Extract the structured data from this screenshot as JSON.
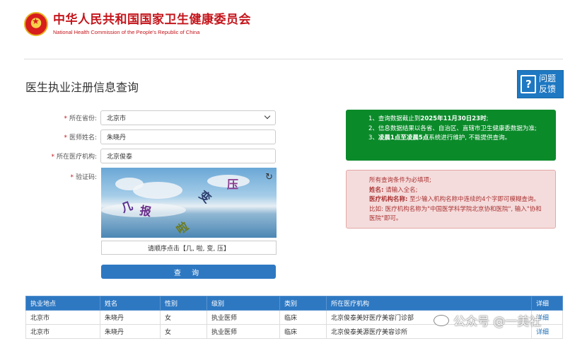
{
  "header": {
    "org_cn": "中华人民共和国国家卫生健康委员会",
    "org_en": "National Health Commission of the People's Republic of China"
  },
  "page_title": "医生执业注册信息查询",
  "feedback": {
    "line1": "问题",
    "line2": "反馈"
  },
  "form": {
    "province": {
      "label": "所在省份:",
      "value": "北京市"
    },
    "doctor_name": {
      "label": "医师姓名:",
      "value": "朱晓丹"
    },
    "institution": {
      "label": "所在医疗机构:",
      "value": "北京俊泰"
    },
    "captcha": {
      "label": "验证码:",
      "chars": [
        "几",
        "报",
        "啦",
        "变",
        "压"
      ],
      "hint": "请顺序点击【几, 啦, 变, 压】"
    },
    "query_button": "查 询"
  },
  "notice_green": {
    "line1_prefix": "1、查询数据截止到",
    "line1_bold": "2025年11月30日23时",
    "line1_suffix": ";",
    "line2": "2、信息数据结果以各省、自治区、直辖市卫生健康委数据为准;",
    "line3_prefix": "3、",
    "line3_bold": "凌晨1点至凌晨5点",
    "line3_suffix": "系统进行维护, 不能提供查询。"
  },
  "notice_red": {
    "line1": "所有查询条件为必填项;",
    "line2_bold": "姓名:",
    "line2": "请输入全名;",
    "line3_bold": "医疗机构名称:",
    "line3": "至少输入机构名称中连续的4个字即可模糊查询。比如: 医疗机构名称为\"中国医学科学院北京协和医院\", 输入\"协和医院\"即可。"
  },
  "table": {
    "headers": [
      "执业地点",
      "姓名",
      "性别",
      "级别",
      "类别",
      "所在医疗机构",
      "详细"
    ],
    "rows": [
      [
        "北京市",
        "朱晓丹",
        "女",
        "执业医师",
        "临床",
        "北京俊泰美好医疗美容门诊部",
        "详细"
      ],
      [
        "北京市",
        "朱晓丹",
        "女",
        "执业医师",
        "临床",
        "北京俊泰美源医疗美容诊所",
        "详细"
      ]
    ]
  },
  "watermark": "公众号 @一美社",
  "colors": {
    "brand_red": "#c4161c",
    "primary_blue": "#2e78c2",
    "notice_green": "#0b8a2a",
    "notice_red_bg": "#f5dcdc"
  }
}
